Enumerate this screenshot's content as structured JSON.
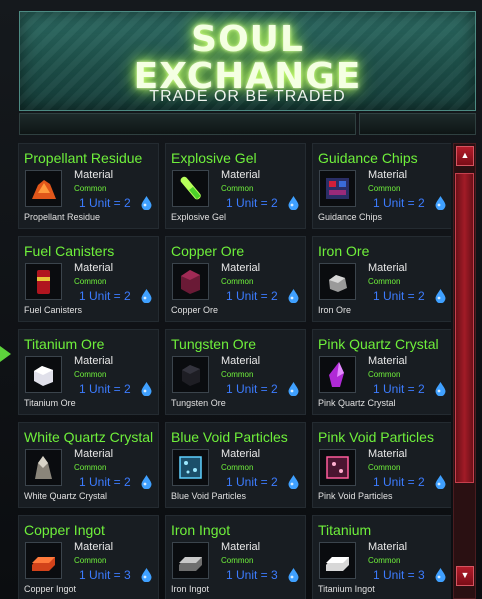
{
  "banner": {
    "title_line1": "SOUL",
    "title_line2": "EXCHANGE",
    "subtitle": "TRADE OR BE TRADED"
  },
  "colors": {
    "accent_green": "#6ff03b",
    "price_blue": "#3c7cff",
    "scroll_red": "#a21b27"
  },
  "items": [
    {
      "name": "Propellant Residue",
      "type": "Material",
      "rarity": "Common",
      "price": "1 Unit = 2",
      "caption": "Propellant Residue",
      "icon": "propellant-residue-icon"
    },
    {
      "name": "Explosive Gel",
      "type": "Material",
      "rarity": "Common",
      "price": "1 Unit = 2",
      "caption": "Explosive Gel",
      "icon": "explosive-gel-icon"
    },
    {
      "name": "Guidance Chips",
      "type": "Material",
      "rarity": "Common",
      "price": "1 Unit = 2",
      "caption": "Guidance Chips",
      "icon": "guidance-chips-icon"
    },
    {
      "name": "Fuel Canisters",
      "type": "Material",
      "rarity": "Common",
      "price": "1 Unit = 2",
      "caption": "Fuel Canisters",
      "icon": "fuel-canisters-icon"
    },
    {
      "name": "Copper Ore",
      "type": "Material",
      "rarity": "Common",
      "price": "1 Unit = 2",
      "caption": "Copper Ore",
      "icon": "copper-ore-icon"
    },
    {
      "name": "Iron Ore",
      "type": "Material",
      "rarity": "Common",
      "price": "1 Unit = 2",
      "caption": "Iron Ore",
      "icon": "iron-ore-icon"
    },
    {
      "name": "Titanium Ore",
      "type": "Material",
      "rarity": "Common",
      "price": "1 Unit = 2",
      "caption": "Titanium Ore",
      "icon": "titanium-ore-icon"
    },
    {
      "name": "Tungsten Ore",
      "type": "Material",
      "rarity": "Common",
      "price": "1 Unit = 2",
      "caption": "Tungsten Ore",
      "icon": "tungsten-ore-icon"
    },
    {
      "name": "Pink Quartz Crystal",
      "type": "Material",
      "rarity": "Common",
      "price": "1 Unit = 2",
      "caption": "Pink Quartz Crystal",
      "icon": "pink-quartz-crystal-icon"
    },
    {
      "name": "White Quartz Crystal",
      "type": "Material",
      "rarity": "Common",
      "price": "1 Unit = 2",
      "caption": "White Quartz Crystal",
      "icon": "white-quartz-crystal-icon"
    },
    {
      "name": "Blue Void Particles",
      "type": "Material",
      "rarity": "Common",
      "price": "1 Unit = 2",
      "caption": "Blue Void Particles",
      "icon": "blue-void-particles-icon"
    },
    {
      "name": "Pink Void Particles",
      "type": "Material",
      "rarity": "Common",
      "price": "1 Unit = 2",
      "caption": "Pink Void Particles",
      "icon": "pink-void-particles-icon"
    },
    {
      "name": "Copper Ingot",
      "type": "Material",
      "rarity": "Common",
      "price": "1 Unit = 3",
      "caption": "Copper Ingot",
      "icon": "copper-ingot-icon"
    },
    {
      "name": "Iron Ingot",
      "type": "Material",
      "rarity": "Common",
      "price": "1 Unit = 3",
      "caption": "Iron Ingot",
      "icon": "iron-ingot-icon"
    },
    {
      "name": "Titanium",
      "type": "Material",
      "rarity": "Common",
      "price": "1 Unit = 3",
      "caption": "Titanium Ingot",
      "icon": "titanium-ingot-icon"
    }
  ]
}
